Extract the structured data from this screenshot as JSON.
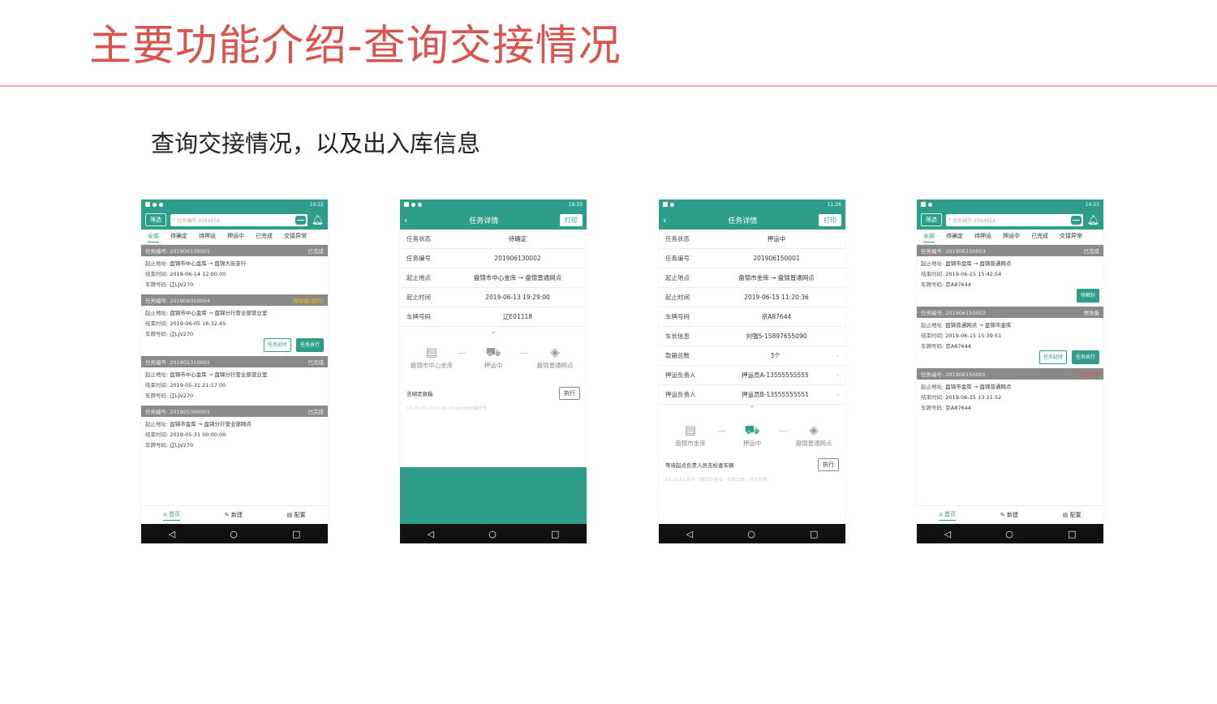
{
  "slide": {
    "title": "主要功能介绍-查询交接情况",
    "subtitle": "查询交接情况，以及出入库信息"
  },
  "list_tabs": [
    "全部",
    "待确定",
    "待押运",
    "押运中",
    "已完成",
    "交接异常"
  ],
  "phone1": {
    "time": "19:22",
    "filter": "筛选",
    "search_placeholder": "任务编号 4564654",
    "cards": [
      {
        "header": "任务编号: 201906130001",
        "status": "已完成",
        "addr_label": "起止地址:",
        "addr": "盘锦市中心金库 → 盘锦大街支行",
        "time_label": "结束时间:",
        "time": "2019-06-14 12:00:00",
        "plate_label": "车牌号码:",
        "plate": "辽LJV270"
      },
      {
        "header": "任务编号: 201906050004",
        "status": "预准备(超时)",
        "addr_label": "起止地址:",
        "addr": "盘锦市中心金库 → 盘锦分行营业部营业室",
        "time_label": "结束时间:",
        "time": "2019-06-05 16:32:45",
        "plate_label": "车牌号码:",
        "plate": "辽LJV270",
        "btn1": "任务延时",
        "btn2": "任务执行"
      },
      {
        "header": "任务编号: 201905310001",
        "status": "已完成",
        "addr_label": "起止地址:",
        "addr": "盘锦市中心金库 → 盘锦分行营业部营业室",
        "time_label": "结束时间:",
        "time": "2019-05-31 21:17:00",
        "plate_label": "车牌号码:",
        "plate": "辽LJV270"
      },
      {
        "header": "任务编号: 201905300001",
        "status": "已完成",
        "addr_label": "起止地址:",
        "addr": "盘锦市金库 → 盘锦分行营业部网点",
        "time_label": "结束时间:",
        "time": "2019-05-31 00:00:00",
        "plate_label": "车牌号码:",
        "plate": "辽LJV270"
      }
    ],
    "nav": [
      "首页",
      "新建",
      "配置"
    ]
  },
  "phone2": {
    "time": "19:33",
    "title": "任务详情",
    "print": "打印",
    "rows": [
      {
        "k": "任务状态",
        "v": "待确定"
      },
      {
        "k": "任务编号",
        "v": "201906130002"
      },
      {
        "k": "起止地点",
        "v": "盘锦市中心金库 → 盘锦普通网点"
      },
      {
        "k": "起止时间",
        "v": "2019-06-13 19:29:00"
      },
      {
        "k": "车牌号码",
        "v": "辽E01118"
      }
    ],
    "steps": [
      "盘锦市中心金库",
      "押运中",
      "盘锦普通网点"
    ],
    "action_label": "去绑定款箱",
    "exec": "执行",
    "faint_log": "19:29:00  2019-06-13   admin创建任务"
  },
  "phone3": {
    "time": "11:26",
    "title": "任务详情",
    "print": "打印",
    "rows": [
      {
        "k": "任务状态",
        "v": "押运中"
      },
      {
        "k": "任务编号",
        "v": "201906150001"
      },
      {
        "k": "起止地点",
        "v": "盘锦市金库 → 盘锦普通网点"
      },
      {
        "k": "起止时间",
        "v": "2019-06-15 11:20:36"
      },
      {
        "k": "车牌号码",
        "v": "京A87644"
      },
      {
        "k": "车长信息",
        "v": "刘强5-15897655090"
      },
      {
        "k": "款箱总数",
        "v": "3个",
        "arrow": "›"
      },
      {
        "k": "押运负责人",
        "v": "押运员A-13555555555",
        "arrow": "›"
      },
      {
        "k": "押运负责人",
        "v": "押运员B-13555555551",
        "arrow": "›"
      }
    ],
    "steps": [
      "盘锦市金库",
      "押运中",
      "盘锦普通网点"
    ],
    "action_label": "等待起点负责人员去检查车辆",
    "exec": "执行",
    "faint_log": "11:21:01  起点（盘锦市金库）交接车辆，押运师傅..."
  },
  "phone4": {
    "time": "14:21",
    "filter": "筛选",
    "search_placeholder": "任务编号 4564654",
    "cards": [
      {
        "header": "任务编号: 201906150003",
        "status": "已完成",
        "addr_label": "起止地址:",
        "addr": "盘锦市金库 → 盘锦普通网点",
        "time_label": "结束时间:",
        "time": "2019-06-15 15:42:54",
        "plate_label": "车牌号码:",
        "plate": "京A87644",
        "btn2": "待解封"
      },
      {
        "header": "任务编号: 201906150002",
        "status": "预准备",
        "addr_label": "起止地址:",
        "addr": "盘锦普通网点 → 盘锦市金库",
        "time_label": "结束时间:",
        "time": "2019-06-15 15:39:51",
        "plate_label": "车牌号码:",
        "plate": "京A87644",
        "btn1": "任务延时",
        "btn2": "任务执行"
      },
      {
        "header": "任务编号: 201906150001",
        "status": "交接异常",
        "addr_label": "起止地址:",
        "addr": "盘锦市金库 → 盘锦普通网点",
        "time_label": "结束时间:",
        "time": "2019-06-15 13:21:52",
        "plate_label": "车牌号码:",
        "plate": "京A87644"
      }
    ],
    "nav": [
      "首页",
      "新建",
      "配置"
    ]
  },
  "android_nav": [
    "◁",
    "○",
    "□"
  ],
  "colors": {
    "accent": "#2e9e8a",
    "title_red": "#d9534f",
    "header_gray": "#8a8a8a",
    "alert": "#d9534f",
    "warn": "#e6c200"
  }
}
